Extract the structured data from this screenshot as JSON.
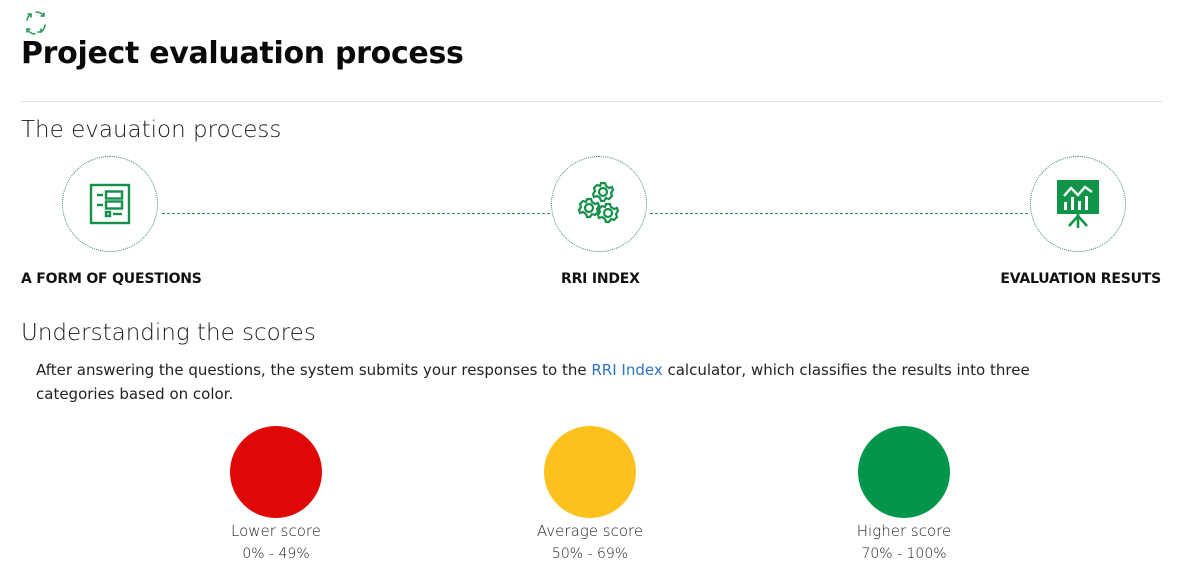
{
  "header": {
    "icon": "refresh-cycle-icon",
    "title": "Project evaluation process"
  },
  "process": {
    "title": "The evauation process",
    "steps": [
      {
        "label": "A FORM OF QUESTIONS",
        "icon": "form-list-icon"
      },
      {
        "label": "RRI INDEX",
        "icon": "gears-icon"
      },
      {
        "label": "EVALUATION RESUTS",
        "icon": "presentation-chart-icon"
      }
    ]
  },
  "scores": {
    "title": "Understanding the scores",
    "description_before": "After answering the questions, the system submits your responses to the ",
    "description_link": "RRI Index",
    "description_after": " calculator, which classifies the results into three categories based on color.",
    "categories": [
      {
        "label": "Lower score",
        "range": "0% - 49%",
        "color": "#e00707"
      },
      {
        "label": "Average score",
        "range": "50% - 69%",
        "color": "#fbc21d"
      },
      {
        "label": "Higher score",
        "range": "70% - 100%",
        "color": "#02964a"
      }
    ]
  },
  "colors": {
    "accent_green": "#0f9448",
    "link_blue": "#2f74c0"
  }
}
